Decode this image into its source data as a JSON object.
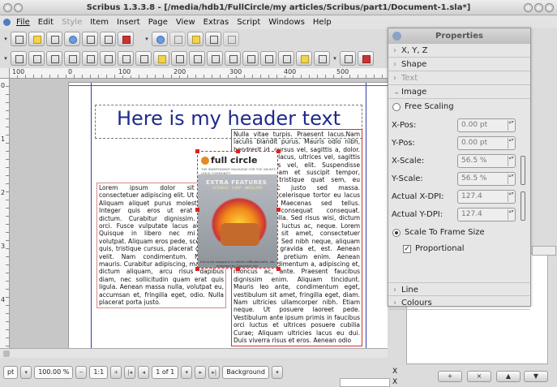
{
  "window": {
    "title": "Scribus 1.3.3.8 - [/media/hdb1/FullCircle/my articles/Scribus/part1/Document-1.sla*]"
  },
  "menu": [
    "File",
    "Edit",
    "Style",
    "Item",
    "Insert",
    "Page",
    "View",
    "Extras",
    "Script",
    "Windows",
    "Help"
  ],
  "menu_disabled": [
    "Style"
  ],
  "ruler_h": [
    "100",
    "0",
    "100",
    "200",
    "300",
    "400",
    "500"
  ],
  "ruler_v": [
    "0",
    "1",
    "2",
    "3",
    "4"
  ],
  "document": {
    "header": "Here is my header text",
    "left_text": "Lorem ipsum dolor sit amet, consectetuer adipiscing elit. Ut a sapien. Aliquam aliquet purus molestie dolor. Integer quis eros ut erat posuere dictum. Curabitur dignissim. Integer orci. Fusce vulputate lacus at ipsum. Quisque in libero nec mi laoreet volutpat. Aliquam eros pede, scelerisque quis, tristique cursus, placerat convallis, velit. Nam condimentum. Nulla ut mauris. Curabitur adipiscing, mauris non dictum aliquam, arcu risus dapibus diam, nec sollicitudin quam erat quis ligula. Aenean massa nulla, volutpat eu, accumsan et, fringilla eget, odio. Nulla placerat porta justo.",
    "right_text": "Nulla vitae turpis. Praesent lacus.Nam iaculis blandit purus. Mauris odio nibh, hendrerit id, cursus vel, sagittis a, dolor. Nullam turpis lacus, ultrices vel, sagittis vitae, dapibus vel, elit. Suspendisse potenti. Aliquam et suscipit tempor, turpis diam tristique quat sem, eu dictum nunc justo sed massa. Pellentesque scelerisque tortor eu lacus sed enim. Maecenas sed tellus. Vestibulum consequat consequat. Praesent fringilla. Sed risus wisi, dictum a, suscipit ac, luctus ac, neque. Lorem ipsum dolor sit amet, consectetuer adipiscing elit. Sed nibh neque, aliquam ut, porta in, gravida et, est. Aenean condimentum, pretium enim. Aenean tellus dui, condimentum a, adipiscing et, rhoncus ac, ante. Praesent faucibus dignissim enim. Aliquam tincidunt. Mauris leo ante, condimentum eget, vestibulum sit amet, fringilla eget, diam. Nam ultricies ullamcorper nibh. Etiam neque. Ut posuere laoreet pede. Vestibulum ante ipsum primis in faucibus orci luctus et ultrices posuere cubilia Curae; Aliquam ultricies lacus eu dui. Duis viverra risus et eros. Aenean odio",
    "image": {
      "logo": "full circle",
      "subtitle": "THE INDEPENDENT MAGAZINE FOR THE UBUNTU LINUX COMMUNITY",
      "feature": "EXTRA FEATURES",
      "feature_sub": "SCRIBUS · GIMP · INKSCAPE",
      "footer": "full circle magazine is neither affiliated with, nor endorsed by Canonical Ltd."
    }
  },
  "statusbar": {
    "unit": "pt",
    "zoom": "100.00 %",
    "ratio": "1:1",
    "page": "1 of 1",
    "layer": "Background"
  },
  "properties": {
    "title": "Properties",
    "sections": [
      "X, Y, Z",
      "Shape",
      "Text",
      "Image"
    ],
    "sections_bottom": [
      "Line",
      "Colours"
    ],
    "free_scaling": "Free Scaling",
    "fields": [
      {
        "label": "X-Pos:",
        "value": "0.00 pt"
      },
      {
        "label": "Y-Pos:",
        "value": "0.00 pt"
      },
      {
        "label": "X-Scale:",
        "value": "56.5 %"
      },
      {
        "label": "Y-Scale:",
        "value": "56.5 %"
      },
      {
        "label": "Actual X-DPI:",
        "value": "127.4"
      },
      {
        "label": "Actual Y-DPI:",
        "value": "127.4"
      }
    ],
    "scale_to_frame": "Scale To Frame Size",
    "proportional": "Proportional"
  },
  "right_panel": {
    "x_label": "X"
  },
  "colors": {
    "header_blue": "#1e2b8a",
    "selection_red": "#dd2222",
    "margin_blue": "#2a3fb0"
  }
}
